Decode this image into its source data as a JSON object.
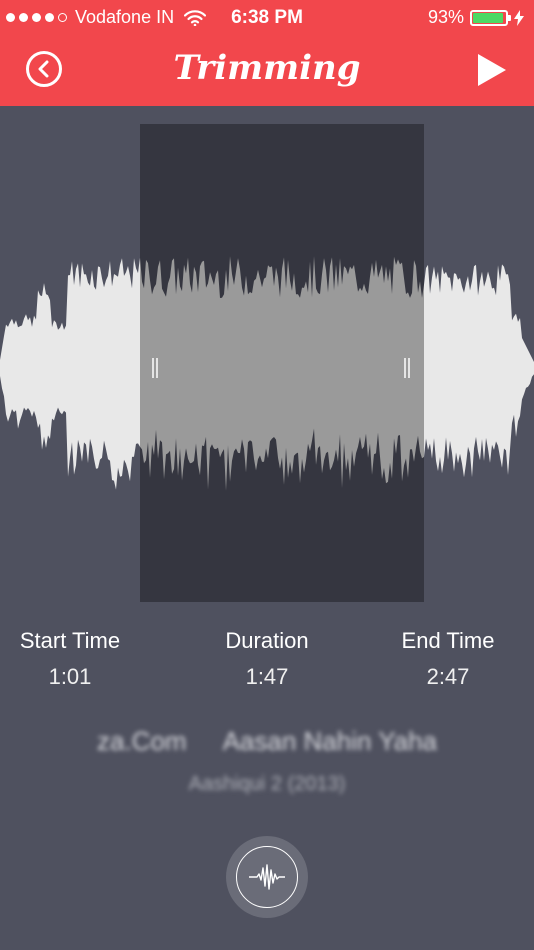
{
  "status_bar": {
    "carrier": "Vodafone IN",
    "time": "6:38 PM",
    "battery_percent": "93%",
    "battery_level": 0.93,
    "battery_color": "#4cd964",
    "signal_bars_filled": 4,
    "signal_bars_total": 5
  },
  "nav": {
    "title": "Trimming",
    "back_icon": "chevron-left-circle-icon",
    "play_icon": "play-icon"
  },
  "colors": {
    "accent": "#f2474c",
    "background": "#4f515f",
    "selection": "#353640",
    "waveform": "#e8e8e8",
    "waveform_selected": "#9a9a9a"
  },
  "trim": {
    "start_label": "Start Time",
    "start_value": "1:01",
    "duration_label": "Duration",
    "duration_value": "1:47",
    "end_label": "End Time",
    "end_value": "2:47"
  },
  "song": {
    "source": "za.Com",
    "title": "Aasan Nahin Yaha",
    "album": "Aashiqui 2 (2013)"
  },
  "record_button": {
    "icon": "waveform-icon"
  }
}
